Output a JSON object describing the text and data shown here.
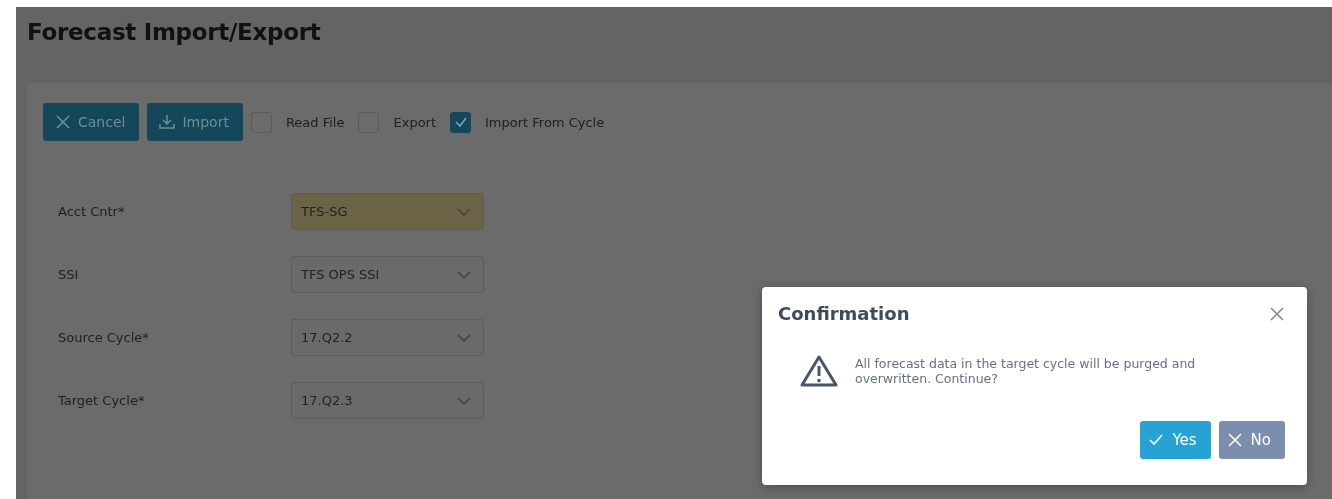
{
  "page": {
    "title": "Forecast Import/Export"
  },
  "toolbar": [
    {
      "kind": "button",
      "label": "Cancel"
    },
    {
      "kind": "button",
      "label": "Import"
    },
    {
      "kind": "checkbox",
      "label": "Read File",
      "checked": false
    },
    {
      "kind": "checkbox",
      "label": "Export",
      "checked": false
    },
    {
      "kind": "checkbox",
      "label": "Import From Cycle",
      "checked": true
    }
  ],
  "fields": [
    {
      "label": "Acct Cntr*",
      "value": "TFS-SG",
      "highlighted": true
    },
    {
      "label": "SSI",
      "value": "TFS OPS SSI",
      "highlighted": false
    },
    {
      "label": "Source Cycle*",
      "value": "17.Q2.2",
      "highlighted": false
    },
    {
      "label": "Target Cycle*",
      "value": "17.Q2.3",
      "highlighted": false
    }
  ],
  "dialog": {
    "title": "Confirmation",
    "message": "All forecast data in the target cycle will be purged and overwritten. Continue?",
    "buttons": [
      {
        "kind": "primary",
        "label": "Yes"
      },
      {
        "kind": "secondary",
        "label": "No"
      }
    ]
  }
}
